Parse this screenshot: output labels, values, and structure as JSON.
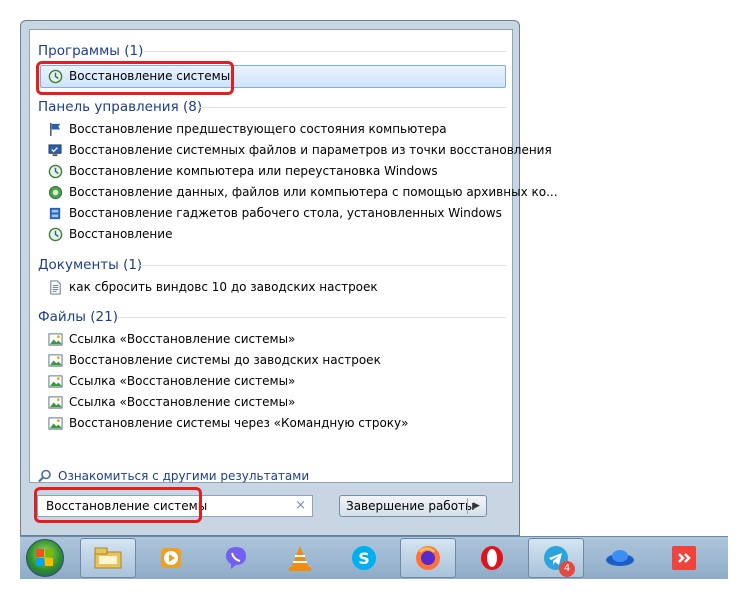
{
  "groups": {
    "programs": {
      "header": "Программы (1)",
      "items": [
        "Восстановление системы"
      ]
    },
    "control_panel": {
      "header": "Панель управления (8)",
      "items": [
        "Восстановление предшествующего состояния компьютера",
        "Восстановление системных файлов и параметров из точки восстановления",
        "Восстановление компьютера или переустановка Windows",
        "Восстановление данных, файлов или компьютера с помощью архивных ко...",
        "Восстановление гаджетов рабочего стола, установленных Windows",
        "Восстановление"
      ]
    },
    "documents": {
      "header": "Документы (1)",
      "items": [
        "как сбросить виндовс 10 до заводских настроек"
      ]
    },
    "files": {
      "header": "Файлы (21)",
      "items": [
        "Ссылка «Восстановление системы»",
        "Восстановление системы до заводских настроек",
        "Ссылка «Восстановление системы»",
        "Ссылка «Восстановление системы»",
        "Восстановление системы через «Командную строку»"
      ]
    }
  },
  "more_results": "Ознакомиться с другими результатами",
  "search": {
    "value": "Восстановление системы",
    "clear_glyph": "×"
  },
  "shutdown": {
    "label": "Завершение работы",
    "arrow_glyph": "▶"
  },
  "taskbar": {
    "apps": [
      {
        "icon": "file-explorer-icon",
        "active": true
      },
      {
        "icon": "media-player-icon",
        "active": false
      },
      {
        "icon": "viber-icon",
        "active": false
      },
      {
        "icon": "vlc-icon",
        "active": false
      },
      {
        "icon": "skype-icon",
        "active": false
      },
      {
        "icon": "firefox-icon",
        "active": true
      },
      {
        "icon": "opera-icon",
        "active": false
      },
      {
        "icon": "telegram-icon",
        "active": true,
        "badge": "4"
      },
      {
        "icon": "yandex-disk-icon",
        "active": false
      },
      {
        "icon": "anydesk-icon",
        "active": false
      }
    ]
  },
  "colors": {
    "highlight": "#e02020",
    "group_header": "#1e3e8a",
    "selection": "#cfe4fa"
  }
}
